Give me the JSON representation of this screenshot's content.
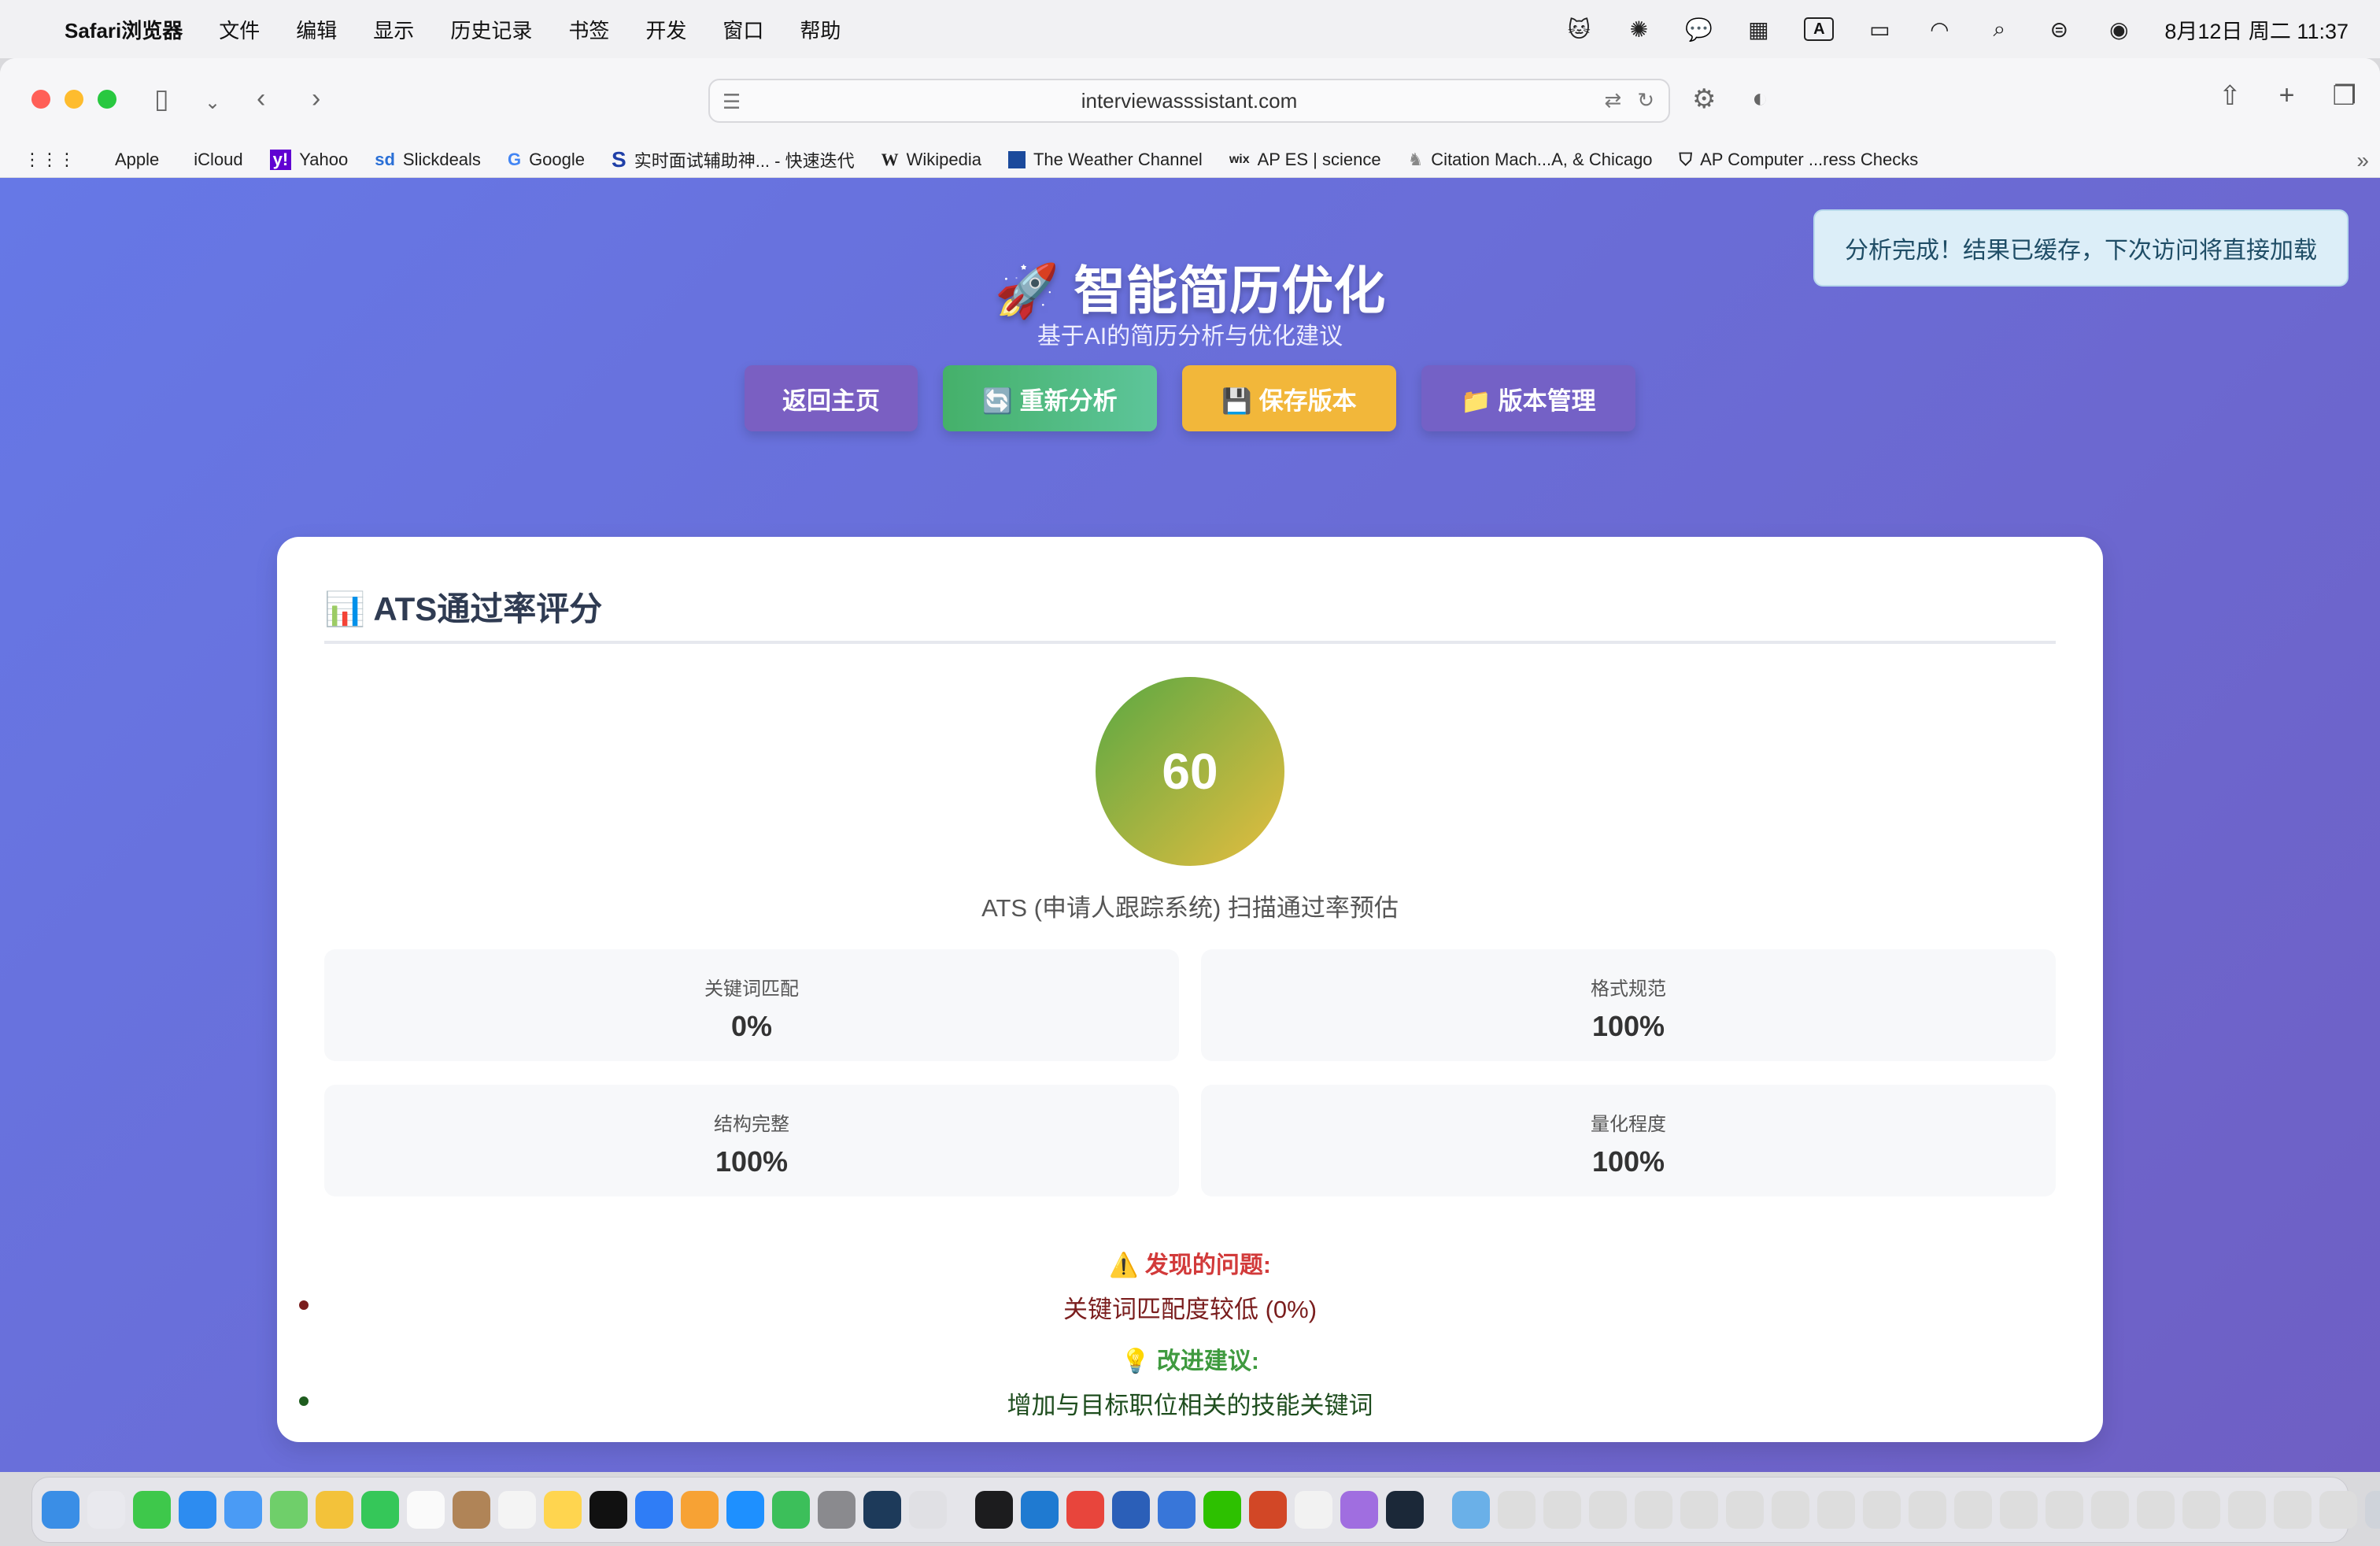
{
  "menubar": {
    "items": [
      "Safari浏览器",
      "文件",
      "编辑",
      "显示",
      "历史记录",
      "书签",
      "开发",
      "窗口",
      "帮助"
    ],
    "datetime": "8月12日 周二  11:37",
    "input_indicator": "A"
  },
  "browser": {
    "url": "interviewasssistant.com",
    "bookmarks": [
      {
        "icon": "",
        "label": "Apple"
      },
      {
        "icon": "",
        "label": "iCloud"
      },
      {
        "icon": "y!",
        "label": "Yahoo"
      },
      {
        "icon": "sd",
        "label": "Slickdeals"
      },
      {
        "icon": "G",
        "label": "Google"
      },
      {
        "icon": "S",
        "label": "实时面试辅助神... - 快速迭代"
      },
      {
        "icon": "W",
        "label": "Wikipedia"
      },
      {
        "icon": "",
        "label": "The Weather Channel"
      },
      {
        "icon": "wix",
        "label": "AP ES | science"
      },
      {
        "icon": "",
        "label": "Citation Mach...A, & Chicago"
      },
      {
        "icon": "",
        "label": "AP Computer ...ress Checks"
      }
    ]
  },
  "page": {
    "title": "🚀 智能简历优化",
    "subtitle": "基于AI的简历分析与优化建议",
    "toast": "分析完成！结果已缓存，下次访问将直接加载",
    "actions": {
      "home": "返回主页",
      "reanalyze": "🔄 重新分析",
      "save": "💾 保存版本",
      "versions": "📁 版本管理"
    },
    "ats": {
      "title": "📊 ATS通过率评分",
      "score": "60",
      "caption": "ATS (申请人跟踪系统) 扫描通过率预估",
      "metrics": [
        {
          "label": "关键词匹配",
          "value": "0%"
        },
        {
          "label": "格式规范",
          "value": "100%"
        },
        {
          "label": "结构完整",
          "value": "100%"
        },
        {
          "label": "量化程度",
          "value": "100%"
        }
      ],
      "issues_title": "⚠️ 发现的问题:",
      "issues": [
        "关键词匹配度较低 (0%)"
      ],
      "tips_title": "💡 改进建议:",
      "tips": [
        "增加与目标职位相关的技能关键词"
      ]
    }
  },
  "colors": {
    "gradient_start": "#6678e6",
    "gradient_end": "#6f5fc4",
    "issue_title": "#d23a3a",
    "tip_title": "#3f9a3f"
  }
}
